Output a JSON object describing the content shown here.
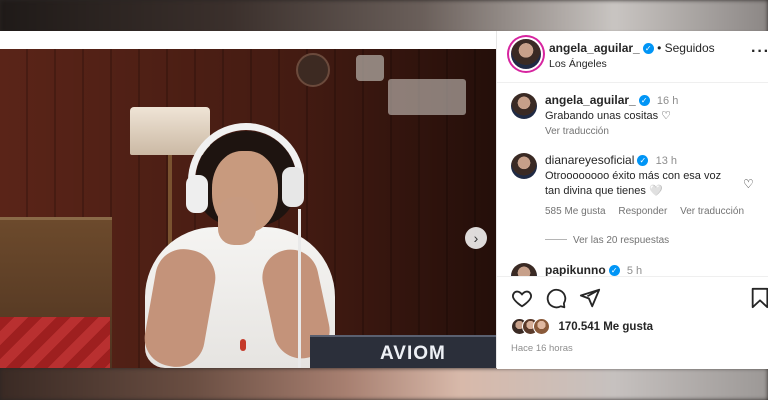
{
  "post": {
    "author": "angela_aguilar_",
    "follow_status": "Seguidos",
    "location": "Los Ángeles",
    "media_text": "AVIOM",
    "next_icon": "chevron-right-icon",
    "more_icon": "more-horizontal-icon"
  },
  "comments": [
    {
      "user": "angela_aguilar_",
      "verified": true,
      "time": "16 h",
      "text": "Grabando unas cositas ♡",
      "action": "Ver traducción"
    },
    {
      "user": "dianareyesoficial",
      "verified": true,
      "time": "13 h",
      "text": "Otroooooooo éxito más con esa voz tan divina que tienes 🤍",
      "likes": "585 Me gusta",
      "reply": "Responder",
      "translate": "Ver traducción",
      "view_replies": "Ver las 20 respuestas"
    },
    {
      "user": "papikunno",
      "verified": true,
      "time": "5 h"
    }
  ],
  "actions": {
    "icons": [
      "heart-icon",
      "comment-icon",
      "share-icon",
      "bookmark-icon"
    ],
    "likes": "170.541 Me gusta",
    "time_ago": "Hace 16 horas"
  }
}
